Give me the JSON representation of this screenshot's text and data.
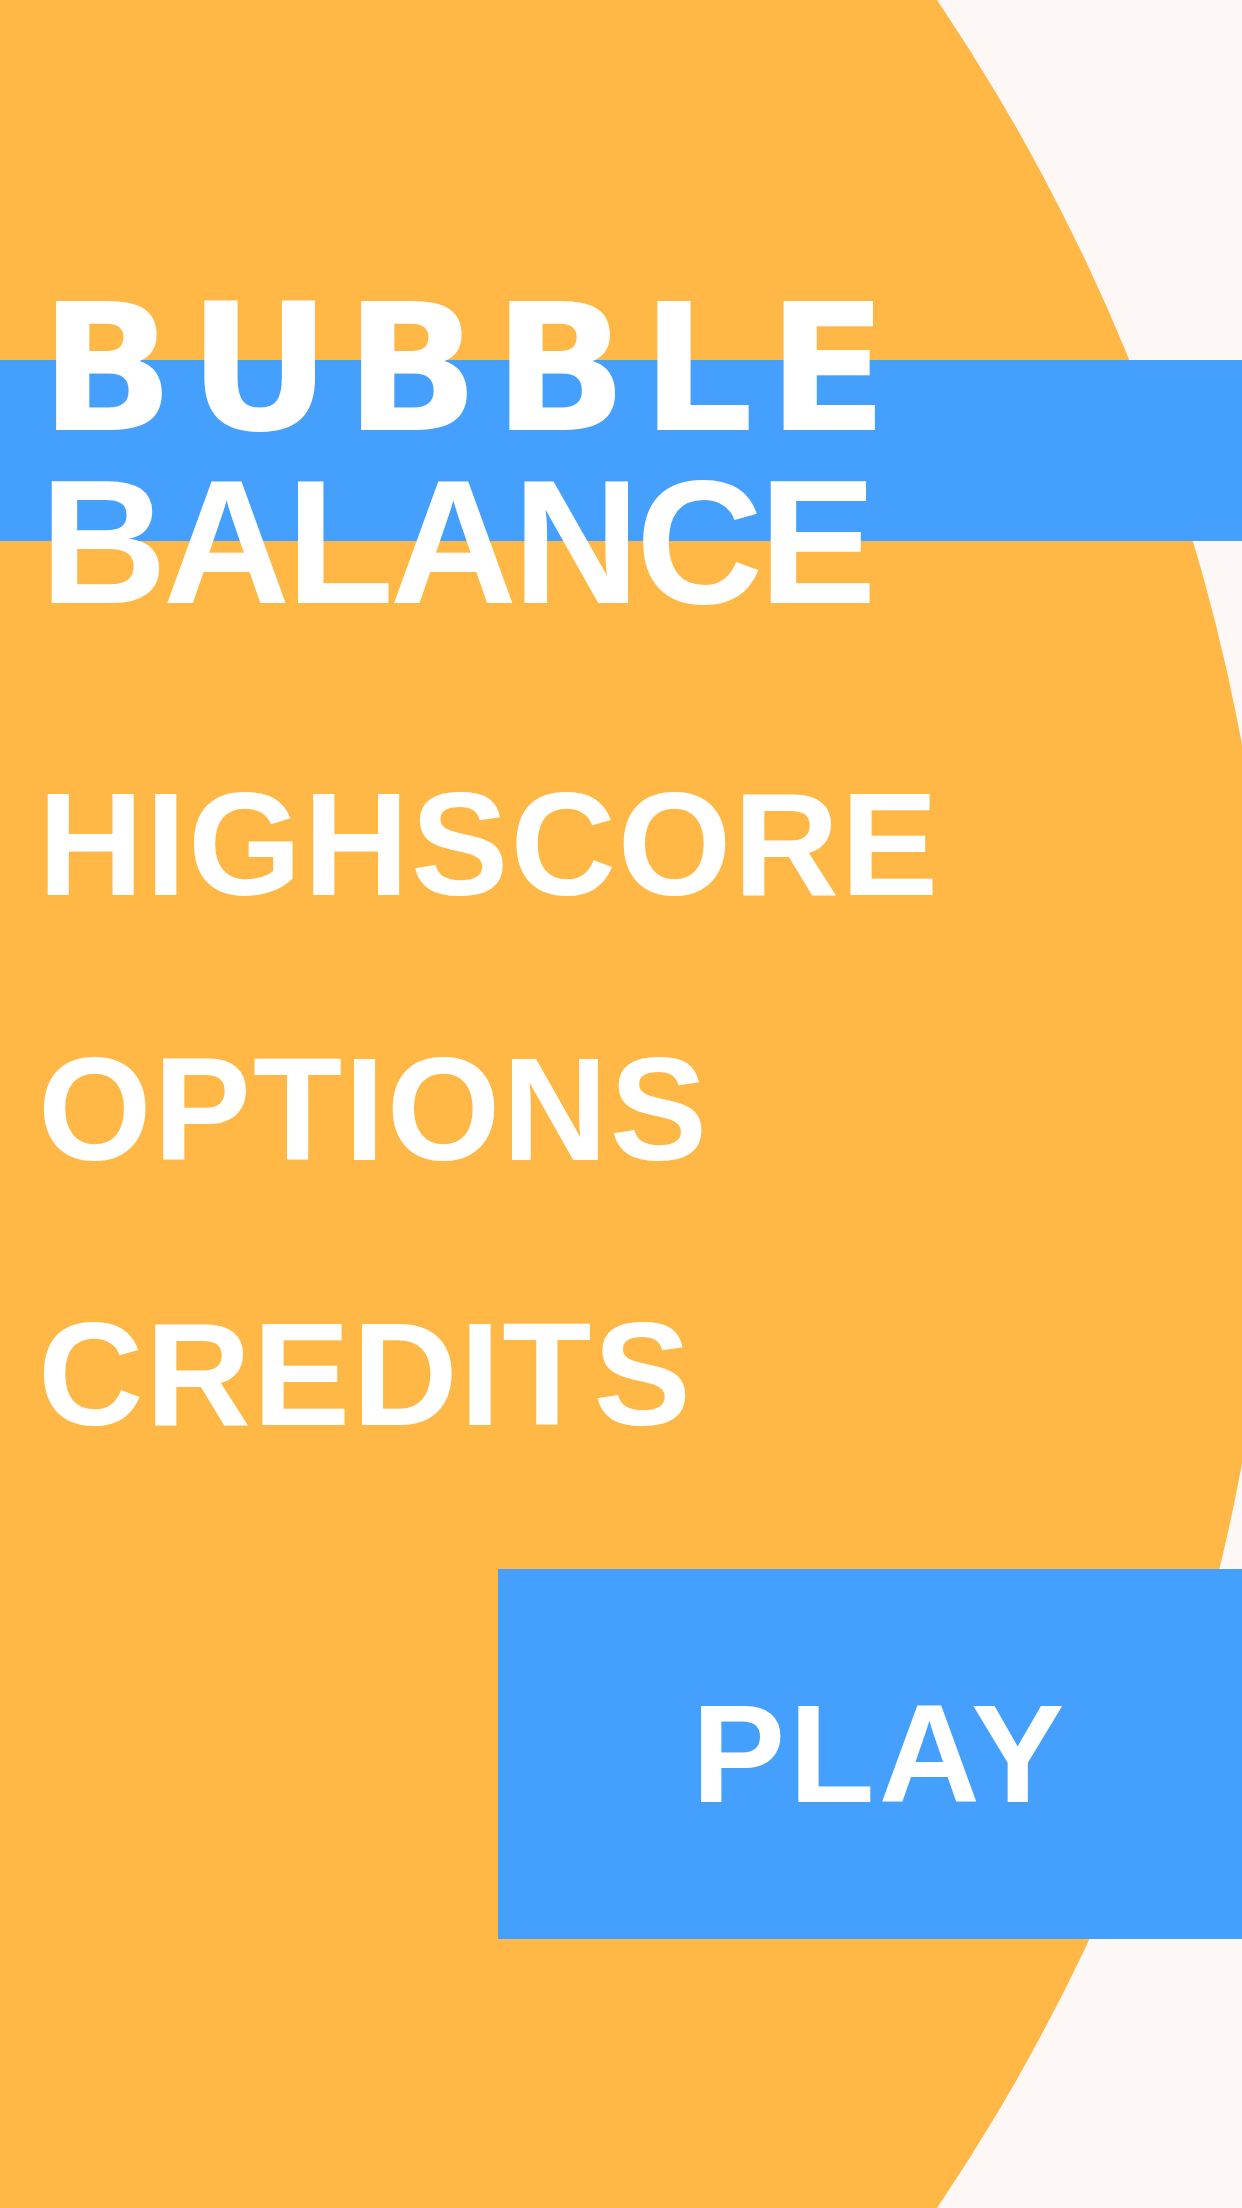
{
  "title": {
    "line_1": "BUBBLE",
    "line_2": "BALANCE"
  },
  "menu": [
    {
      "label": "HIGHSCORE"
    },
    {
      "label": "OPTIONS"
    },
    {
      "label": "CREDITS"
    }
  ],
  "play_button": {
    "label": "PLAY"
  }
}
